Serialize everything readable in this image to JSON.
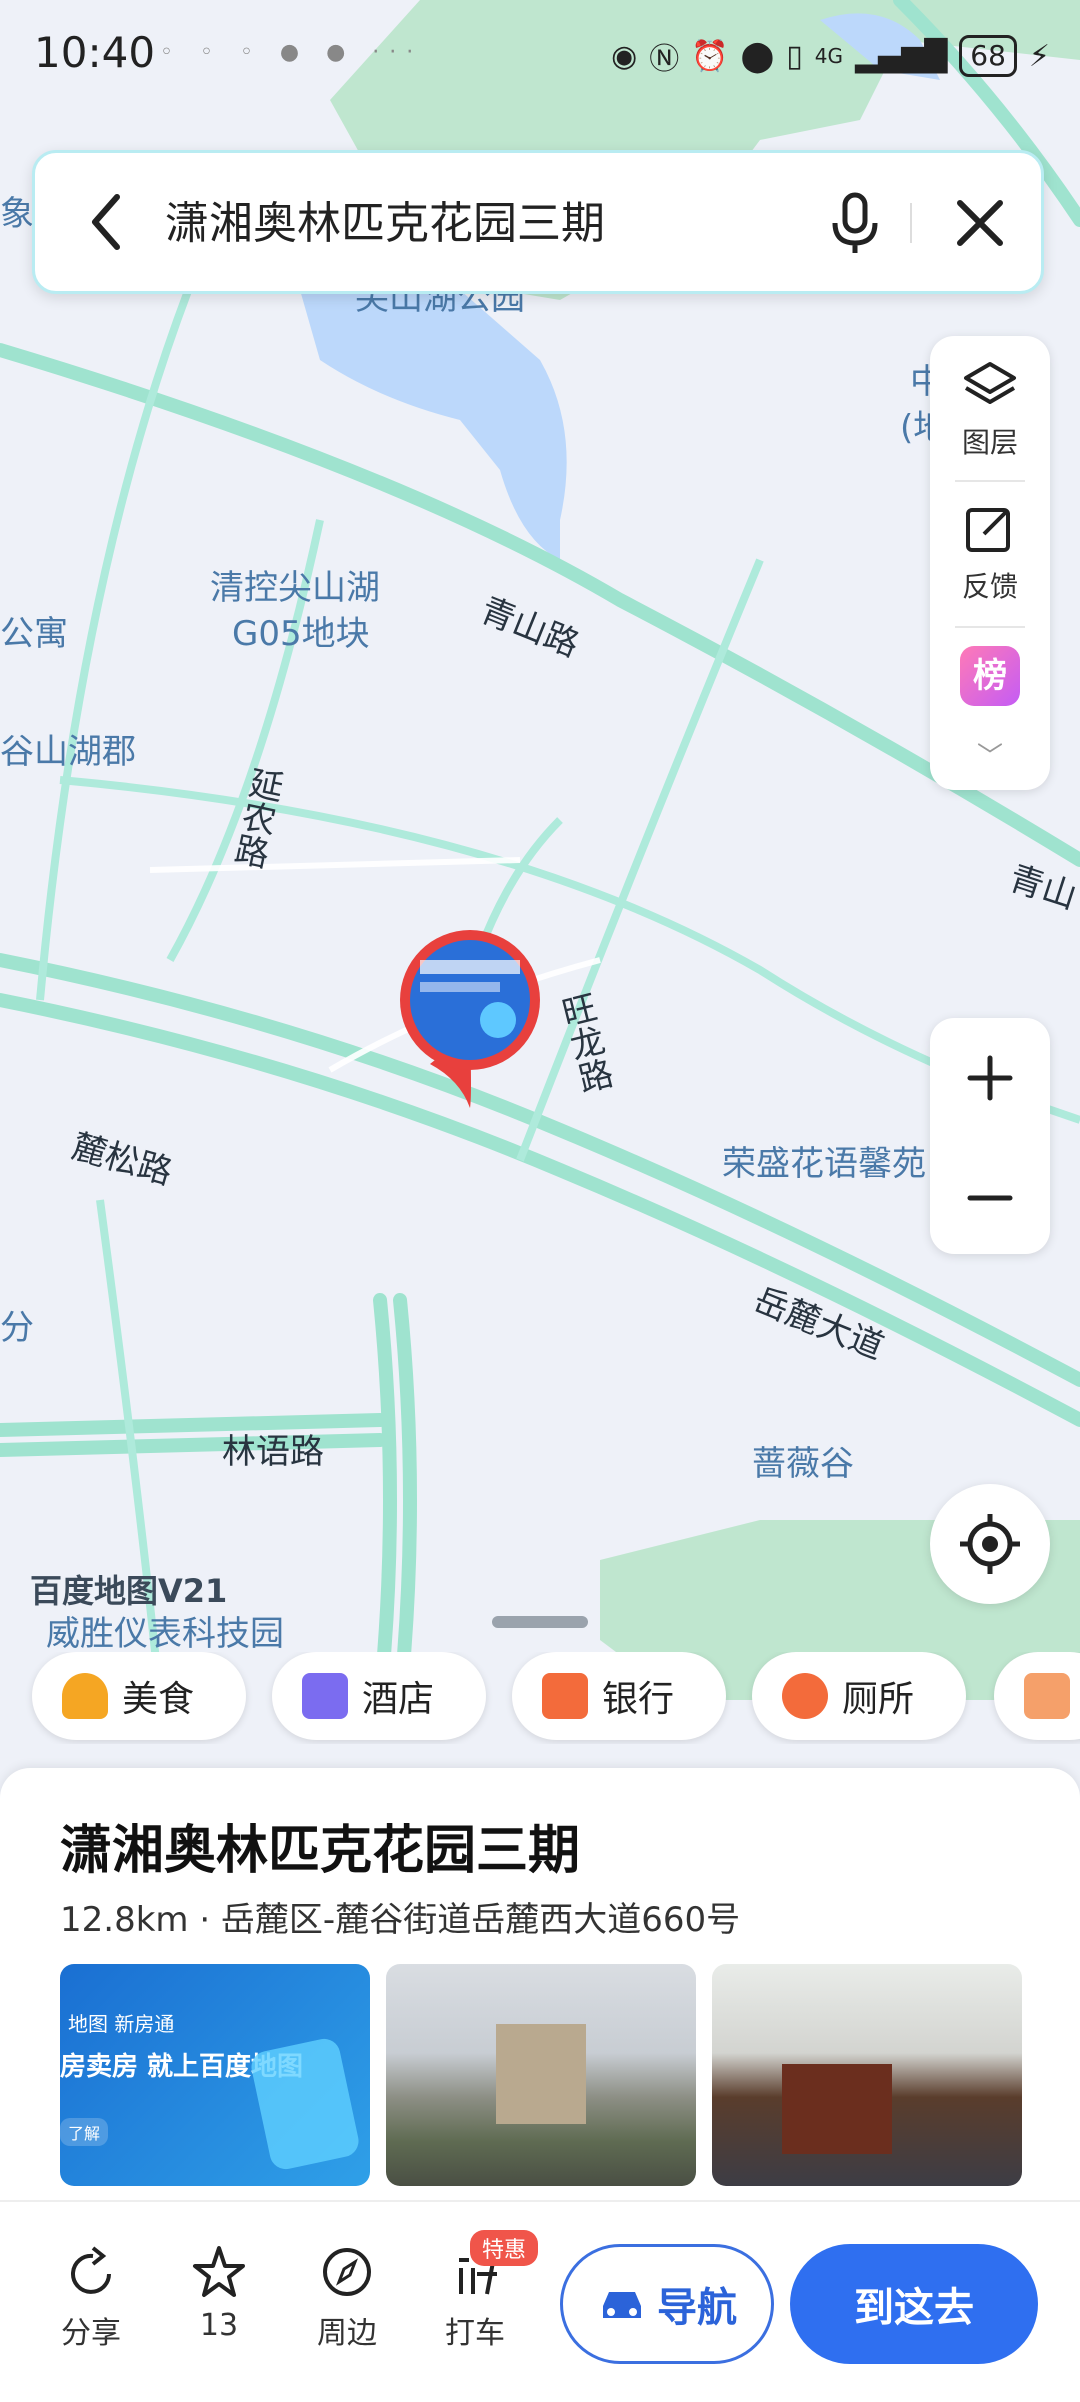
{
  "status_bar": {
    "time": "10:40",
    "network": "4G",
    "battery": "68"
  },
  "search": {
    "query": "潇湘奥林匹克花园三期"
  },
  "side_panel": {
    "layers_label": "图层",
    "feedback_label": "反馈",
    "ranking_label": "榜"
  },
  "map": {
    "watermark": "百度地图V21",
    "labels": {
      "park": "尖山湖公园",
      "parcel_line1": "清控尖山湖",
      "parcel_line2": "G05地块",
      "road_qingshan": "青山路",
      "road_qingshan_right": "青山",
      "road_yannong": "延农路",
      "road_wanglong": "旺龙路",
      "road_lusong": "麓松路",
      "road_yuelu": "岳麓大道",
      "road_linyu": "林语路",
      "community_rongsheng": "荣盛花语馨苑",
      "community_qiangwei": "蔷薇谷",
      "park_yuan": "威胜仪表科技园",
      "left_apartment": "公寓",
      "left_gushan": "谷山湖郡",
      "left_xiang": "象",
      "left_fen": "分",
      "right_zhongxun": "中讯",
      "right_site": "(地)"
    }
  },
  "categories": [
    {
      "label": "美食",
      "icon": "food-icon",
      "color": "#f5a623"
    },
    {
      "label": "酒店",
      "icon": "hotel-icon",
      "color": "#7b6cf0"
    },
    {
      "label": "银行",
      "icon": "bank-icon",
      "color": "#f36b3b"
    },
    {
      "label": "厕所",
      "icon": "toilet-icon",
      "color": "#f36b3b"
    }
  ],
  "place": {
    "name": "潇湘奥林匹克花园三期",
    "distance_address": "12.8km · 岳麓区-麓谷街道岳麓西大道660号",
    "photos": [
      {
        "type": "ad-banner",
        "line1": "地图 新房通",
        "line2": "房卖房 就上百度地图",
        "line3": "了解"
      },
      {
        "type": "gate-photo"
      },
      {
        "type": "people-photo"
      }
    ]
  },
  "actions": {
    "share_label": "分享",
    "favorite_count": "13",
    "nearby_label": "周边",
    "taxi_label": "打车",
    "taxi_badge": "特惠",
    "navigate_label": "导航",
    "go_label": "到这去"
  }
}
